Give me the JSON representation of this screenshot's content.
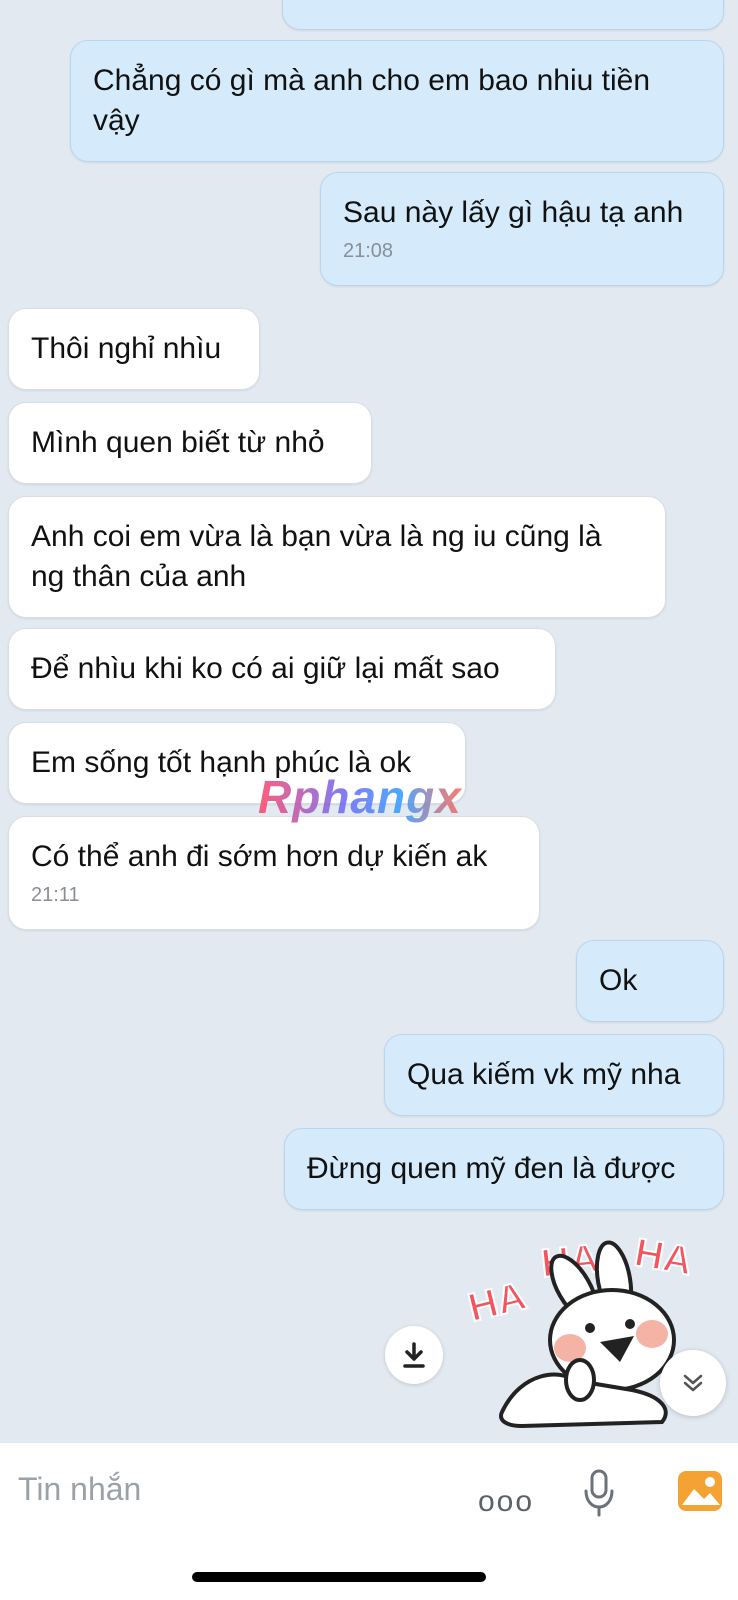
{
  "messages": [
    {
      "text": "Chẳng có gì mà anh cho em bao nhiu tiền vậy",
      "time": ""
    },
    {
      "text": "Sau này lấy gì hậu tạ anh",
      "time": "21:08"
    },
    {
      "text": "Thôi nghỉ nhìu",
      "time": ""
    },
    {
      "text": "Mình quen biết từ nhỏ",
      "time": ""
    },
    {
      "text": "Anh coi em vừa là bạn vừa là ng iu cũng là ng thân của anh",
      "time": ""
    },
    {
      "text": "Để nhìu khi ko có ai giữ lại mất sao",
      "time": ""
    },
    {
      "text": "Em sống tốt hạnh phúc là ok",
      "time": ""
    },
    {
      "text": "Có thể anh đi sớm hơn dự kiến ak",
      "time": "21:11"
    },
    {
      "text": "Ok",
      "time": ""
    },
    {
      "text": "Qua kiếm vk mỹ nha",
      "time": ""
    },
    {
      "text": "Đừng quen mỹ đen là được",
      "time": ""
    }
  ],
  "watermark": "Rphangx",
  "sticker": {
    "text": "HA HA HA"
  },
  "composer": {
    "placeholder": "Tin nhắn",
    "more_label": "ooo"
  },
  "colors": {
    "background": "#e2e9f1",
    "outgoing_bubble": "#d5ebfb",
    "incoming_bubble": "#ffffff",
    "image_button": "#f5a234"
  },
  "icons": [
    "download-icon",
    "chevron-double-down-icon",
    "mic-icon",
    "image-icon"
  ]
}
